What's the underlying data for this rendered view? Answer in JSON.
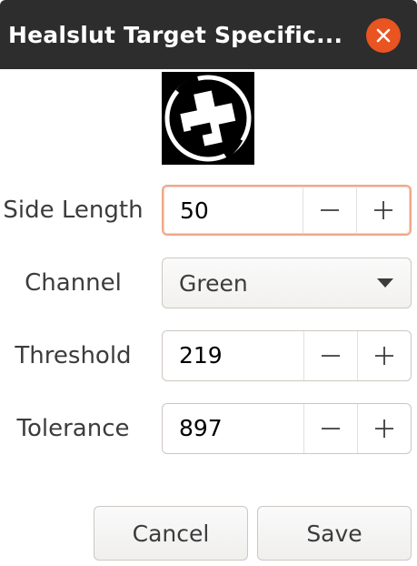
{
  "window": {
    "title": "Healslut Target Specific..."
  },
  "fields": {
    "side_length": {
      "label": "Side Length",
      "value": "50"
    },
    "channel": {
      "label": "Channel",
      "value": "Green"
    },
    "threshold": {
      "label": "Threshold",
      "value": "219"
    },
    "tolerance": {
      "label": "Tolerance",
      "value": "897"
    }
  },
  "buttons": {
    "cancel": "Cancel",
    "save": "Save"
  },
  "colors": {
    "titlebar": "#2d2d2d",
    "close": "#e95420",
    "focus_border": "#f0a889"
  },
  "icons": {
    "close": "close-icon",
    "decrement": "minus-icon",
    "increment": "plus-icon",
    "dropdown": "chevron-down-icon"
  }
}
